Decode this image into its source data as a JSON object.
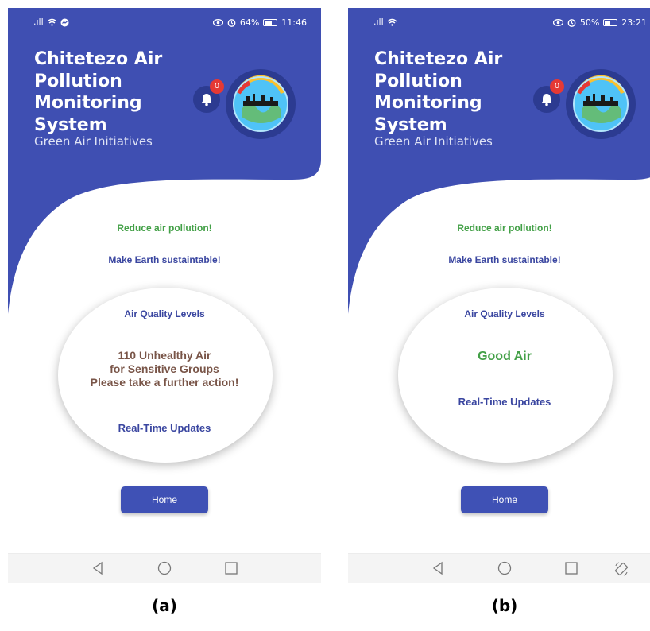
{
  "colors": {
    "header_blue": "#3f4fb2",
    "accent_green": "#43a047",
    "text_blue": "#3a46a0",
    "warning_brown": "#795548",
    "badge_red": "#e53935"
  },
  "panels": [
    {
      "caption": "(a)",
      "status_bar": {
        "signal": ".ıll",
        "battery": "64%",
        "battery_level": 0.64,
        "time": "11:46"
      },
      "app_title": "Chitetezo Air Pollution Monitoring System",
      "app_subtitle": "Green Air Initiatives",
      "notification_count": "0",
      "slogans": [
        "Reduce air pollution!",
        "Make Earth sustaintable!"
      ],
      "air_quality": {
        "title": "Air Quality Levels",
        "status_lines": [
          "110 Unhealthy Air",
          "for Sensitive Groups",
          "Please take a further action!"
        ],
        "updates_label": "Real-Time Updates"
      },
      "home_button": "Home",
      "nav_icons": [
        "back-icon",
        "home-circle-icon",
        "recent-apps-icon"
      ]
    },
    {
      "caption": "(b)",
      "status_bar": {
        "signal": ".ıll",
        "battery": "50%",
        "battery_level": 0.5,
        "time": "23:21"
      },
      "app_title": "Chitetezo Air Pollution Monitoring System",
      "app_subtitle": "Green Air Initiatives",
      "notification_count": "0",
      "slogans": [
        "Reduce air pollution!",
        "Make Earth sustaintable!"
      ],
      "air_quality": {
        "title": "Air Quality Levels",
        "status_lines": [
          "Good Air"
        ],
        "updates_label": "Real-Time Updates"
      },
      "home_button": "Home",
      "nav_icons": [
        "back-icon",
        "home-circle-icon",
        "recent-apps-icon",
        "rotate-screen-icon"
      ]
    }
  ]
}
